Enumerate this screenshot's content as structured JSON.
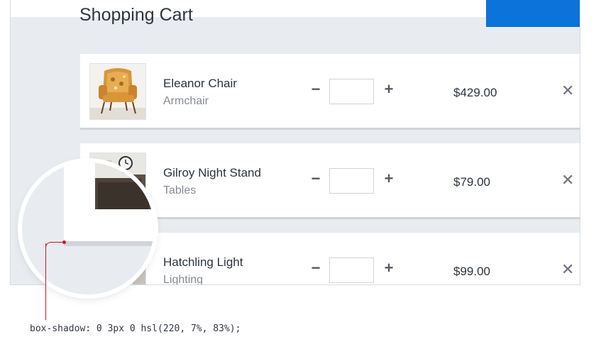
{
  "cart": {
    "title": "Shopping Cart",
    "items": [
      {
        "name": "Eleanor Chair",
        "category": "Armchair",
        "price": "$429.00",
        "quantity": "",
        "minus_glyph": "−",
        "plus_glyph": "+",
        "remove_glyph": "✕"
      },
      {
        "name": "Gilroy Night Stand",
        "category": "Tables",
        "price": "$79.00",
        "quantity": "",
        "minus_glyph": "−",
        "plus_glyph": "+",
        "remove_glyph": "✕"
      },
      {
        "name": "Hatchling Light",
        "category": "Lighting",
        "price": "$99.00",
        "quantity": "",
        "minus_glyph": "−",
        "plus_glyph": "+",
        "remove_glyph": "✕"
      }
    ]
  },
  "annotation": {
    "code": "box-shadow: 0 3px 0 hsl(220, 7%, 83%);"
  },
  "colors": {
    "accent": "#0b73d9",
    "page_background": "#e8ebf0",
    "card_shadow": "hsl(220, 7%, 83%)",
    "callout": "#d0122e"
  }
}
